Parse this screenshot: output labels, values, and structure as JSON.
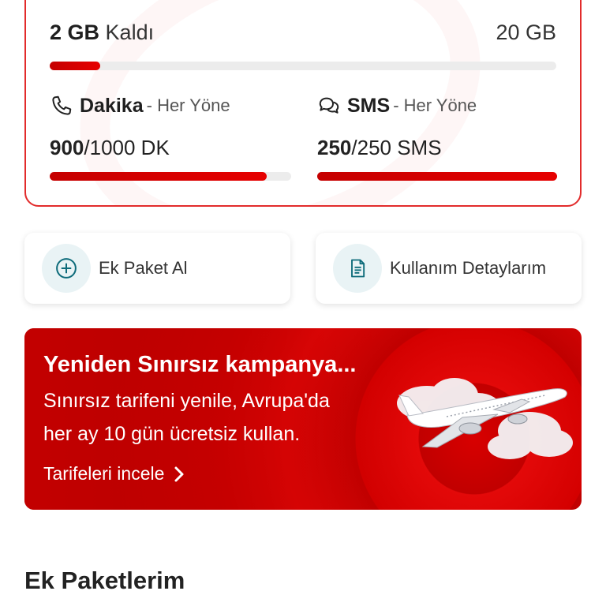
{
  "usage": {
    "data": {
      "used": "2 GB",
      "used_suffix": "Kaldı",
      "total": "20 GB",
      "remaining_fraction": 0.1
    },
    "minutes": {
      "title": "Dakika",
      "direction": "- Her Yöne",
      "remaining": "900",
      "total_text": "/1000 DK",
      "remaining_fraction": 0.9,
      "icon": "phone-icon"
    },
    "sms": {
      "title": "SMS",
      "direction": "- Her Yöne",
      "remaining": "250",
      "total_text": "/250 SMS",
      "remaining_fraction": 1.0,
      "icon": "chat-bubbles-icon"
    }
  },
  "actions": [
    {
      "label": "Ek Paket Al",
      "icon": "add-circle-icon"
    },
    {
      "label": "Kullanım Detaylarım",
      "icon": "document-icon"
    }
  ],
  "banner": {
    "title": "Yeniden Sınırsız kampanya...",
    "line1": "Sınırsız tarifeni yenile, Avrupa'da",
    "line2": "her ay 10 gün ücretsiz kullan.",
    "link": "Tarifeleri incele",
    "image": "airplane-illustration"
  },
  "section": {
    "title": "Ek Paketlerim"
  },
  "colors": {
    "accent": "#e60000",
    "card_border": "#e22b2b",
    "icon_bg": "#e9f3f5",
    "icon_color": "#0d6b7a"
  }
}
